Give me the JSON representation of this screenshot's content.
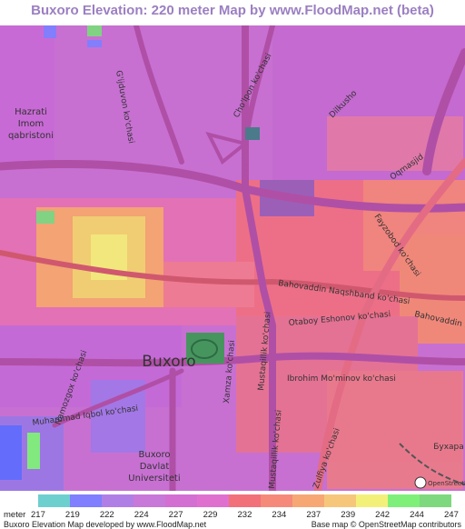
{
  "title": "Buxoro Elevation: 220 meter Map by www.FloodMap.net (beta)",
  "map": {
    "city_label": "Buxoro",
    "street_labels": {
      "gijduvon": "G'ijduvon ko'chasi",
      "cholpon": "Cho'lpon ko'chasi",
      "dilkusho": "Dilkusho",
      "oqmasjid": "Oqmasjid",
      "fayzobod": "Fayzobod ko'chasi",
      "naqshband": "Bahovaddin Naqshband ko'chasi",
      "bahovaddin_right": "Bahovaddin Naq",
      "otaboy": "Otaboy Eshonov ko'chasi",
      "ibrohim": "Ibrohim Mo'minov ko'chasi",
      "mustaqillik": "Mustaqillik ko'chasi",
      "mustaqillik_south": "Mustaqillik ko'chasi",
      "xamza": "Xamza ko'chasi",
      "namozgox": "Namozgox ko'chasi",
      "iqbol": "Muhammad Iqbol ko'chasi",
      "zulfiya": "Zulfiya ko'chasi",
      "hazrati_line1": "Hazrati",
      "hazrati_line2": "Imom",
      "hazrati_line3": "qabristoni",
      "university_line1": "Buxoro",
      "university_line2": "Davlat",
      "university_line3": "Universiteti",
      "railway_label": "Бухара",
      "osm_badge": "OpenStreetMap"
    }
  },
  "legend": {
    "unit": "meter",
    "tick_labels": [
      "217",
      "219",
      "222",
      "224",
      "227",
      "229",
      "232",
      "234",
      "237",
      "239",
      "242",
      "244",
      "247"
    ],
    "colors": [
      "#6ecfcf",
      "#7f7fff",
      "#b07fe6",
      "#c878d8",
      "#d36fd2",
      "#e070d0",
      "#f2707a",
      "#f58a7a",
      "#f6a774",
      "#f6c77a",
      "#f3f07a",
      "#7ef07a",
      "#7ed87e"
    ],
    "credit_left": "Buxoro Elevation Map developed by www.FloodMap.net",
    "credit_right": "Base map © OpenStreetMap contributors"
  }
}
